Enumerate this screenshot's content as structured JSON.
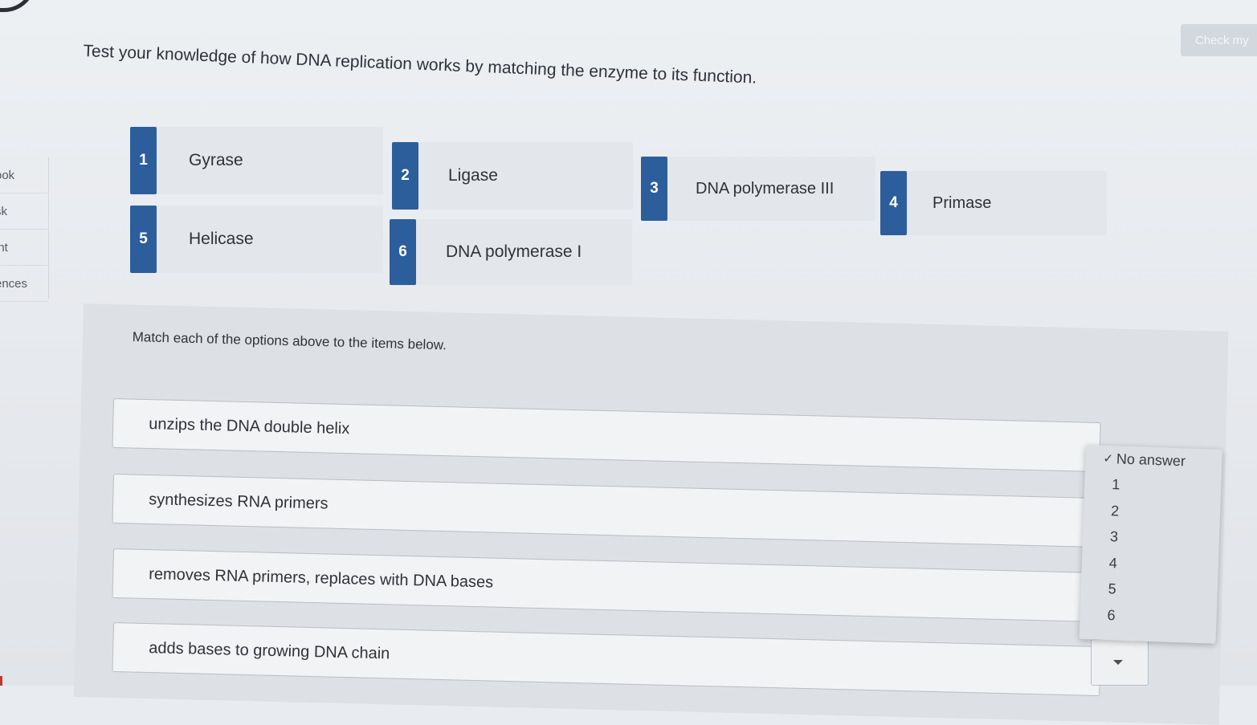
{
  "instruction": "Test your knowledge of how DNA replication works by matching the enzyme to its function.",
  "check_button": "Check my",
  "sidebar": {
    "items": [
      {
        "label": "ook"
      },
      {
        "label": "sk"
      },
      {
        "label": "int"
      },
      {
        "label": "ences"
      }
    ]
  },
  "options": [
    {
      "num": "1",
      "label": "Gyrase"
    },
    {
      "num": "2",
      "label": "Ligase"
    },
    {
      "num": "3",
      "label": "DNA polymerase III"
    },
    {
      "num": "4",
      "label": "Primase"
    },
    {
      "num": "5",
      "label": "Helicase"
    },
    {
      "num": "6",
      "label": "DNA polymerase I"
    }
  ],
  "match_instruction": "Match each of the options above to the items below.",
  "items": [
    {
      "text": "unzips the DNA double helix"
    },
    {
      "text": "synthesizes RNA primers"
    },
    {
      "text": "removes RNA primers, replaces with DNA bases"
    },
    {
      "text": "adds bases to growing DNA chain"
    }
  ],
  "dropdown": {
    "check_glyph": "✓",
    "options": [
      "No answer",
      "1",
      "2",
      "3",
      "4",
      "5",
      "6"
    ],
    "selected": "No answer"
  }
}
